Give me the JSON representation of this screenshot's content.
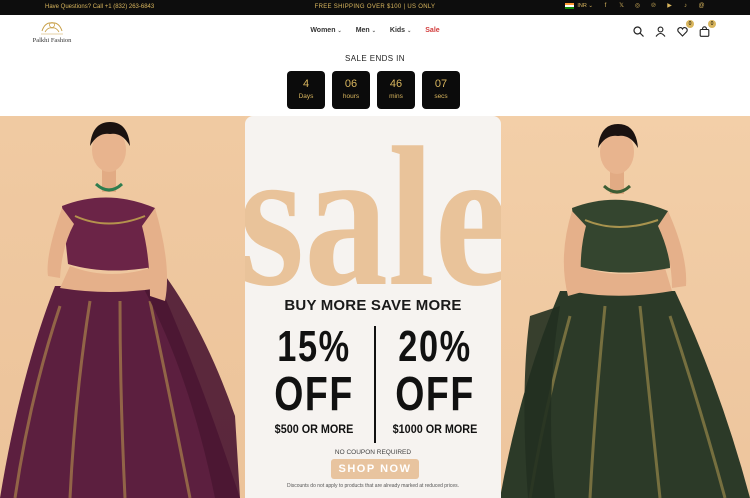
{
  "topbar": {
    "contact": "Have Questions? Call +1 (832) 263-6843",
    "shipping": "FREE SHIPPING OVER $100 | US ONLY",
    "currency": "INR ⌄",
    "social_icons": [
      "facebook-icon",
      "x-icon",
      "instagram-icon",
      "pinterest-icon",
      "youtube-icon",
      "tiktok-icon",
      "threads-icon"
    ]
  },
  "header": {
    "logo_text": "Palkhi Fashion",
    "nav": [
      {
        "label": "Women",
        "has_dropdown": true
      },
      {
        "label": "Men",
        "has_dropdown": true
      },
      {
        "label": "Kids",
        "has_dropdown": true
      },
      {
        "label": "Sale",
        "has_dropdown": false,
        "color": "#d23b3b"
      }
    ],
    "wishlist_count": "0",
    "cart_count": "0"
  },
  "countdown": {
    "title": "SALE ENDS IN",
    "units": [
      {
        "value": "4",
        "label": "Days"
      },
      {
        "value": "06",
        "label": "hours"
      },
      {
        "value": "46",
        "label": "mins"
      },
      {
        "value": "07",
        "label": "secs"
      }
    ]
  },
  "banner": {
    "headline": "sale",
    "subheadline": "BUY MORE SAVE MORE",
    "offers": [
      {
        "percent": "15%",
        "off": "OFF",
        "minimum": "$500 OR MORE"
      },
      {
        "percent": "20%",
        "off": "OFF",
        "minimum": "$1000 OR MORE"
      }
    ],
    "no_coupon": "NO COUPON REQUIRED",
    "cta": "SHOP NOW",
    "disclaimer": "Discounts do not apply to products that are already marked at reduced prices."
  },
  "colors": {
    "gold": "#d9b65e",
    "topbar_bg": "#0d0d0d",
    "banner_bg": "#f1cba3",
    "sale_text": "#e9c39a",
    "cta_bg": "#e8c49f",
    "left_outfit": "#5c1f3f",
    "right_outfit": "#2c3a28"
  }
}
